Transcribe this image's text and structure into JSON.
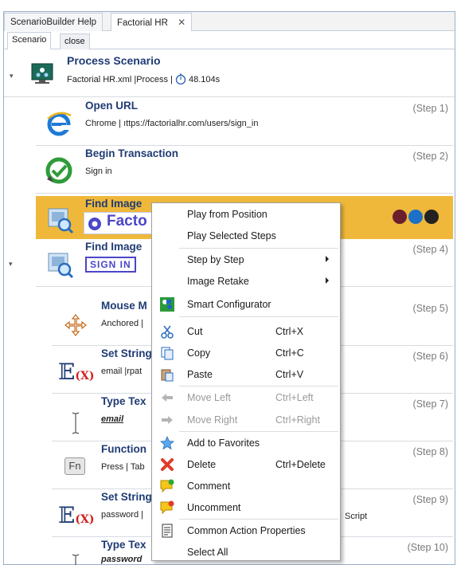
{
  "tabs": [
    {
      "label": "ScenarioBuilder Help"
    },
    {
      "label": "Factorial HR",
      "close": "✕"
    }
  ],
  "subtabs": [
    {
      "label": "Scenario"
    },
    {
      "label": "close"
    }
  ],
  "process": {
    "title": "Process Scenario",
    "file": "Factorial HR.xml",
    "type": "|Process |",
    "duration": "48.104s"
  },
  "steps": [
    {
      "title": "Open URL",
      "sub": "Chrome | ıttps://factorialhr.com/users/sign_in",
      "num": "(Step 1)"
    },
    {
      "title": "Begin Transaction",
      "sub": "Sign in",
      "num": "(Step 2)"
    },
    {
      "title": "Find Image",
      "sub": "Facto",
      "num": ""
    },
    {
      "title": "Find Image",
      "sub": "SIGN IN",
      "num": "(Step 4)"
    },
    {
      "title": "Mouse M",
      "sub": "Anchored |",
      "num": "(Step 5)"
    },
    {
      "title": "Set String",
      "sub": "email |rpat",
      "num": "(Step 6)"
    },
    {
      "title": "Type Tex",
      "sub": "email",
      "num": "(Step 7)"
    },
    {
      "title": "Function",
      "sub": "Press | Tab",
      "num": "(Step 8)"
    },
    {
      "title": "Set String",
      "sub": "password |",
      "num": "(Step 9)",
      "tail": "Script"
    },
    {
      "title": "Type Tex",
      "sub": "password",
      "num": "(Step 10)"
    }
  ],
  "context_menu": {
    "items": [
      {
        "label": "Play from Position"
      },
      {
        "label": "Play Selected Steps"
      },
      {
        "label": "Step by Step"
      },
      {
        "label": "Image Retake"
      },
      {
        "label": "Smart Configurator"
      },
      {
        "label": "Cut",
        "shortcut": "Ctrl+X"
      },
      {
        "label": "Copy",
        "shortcut": "Ctrl+C"
      },
      {
        "label": "Paste",
        "shortcut": "Ctrl+V"
      },
      {
        "label": "Move Left",
        "shortcut": "Ctrl+Left"
      },
      {
        "label": "Move Right",
        "shortcut": "Ctrl+Right"
      },
      {
        "label": "Add to Favorites"
      },
      {
        "label": "Delete",
        "shortcut": "Ctrl+Delete"
      },
      {
        "label": "Comment"
      },
      {
        "label": "Uncomment"
      },
      {
        "label": "Common Action Properties"
      },
      {
        "label": "Select All"
      }
    ]
  },
  "colors": {
    "highlight": "#efb83a",
    "title": "#1f3b74"
  }
}
